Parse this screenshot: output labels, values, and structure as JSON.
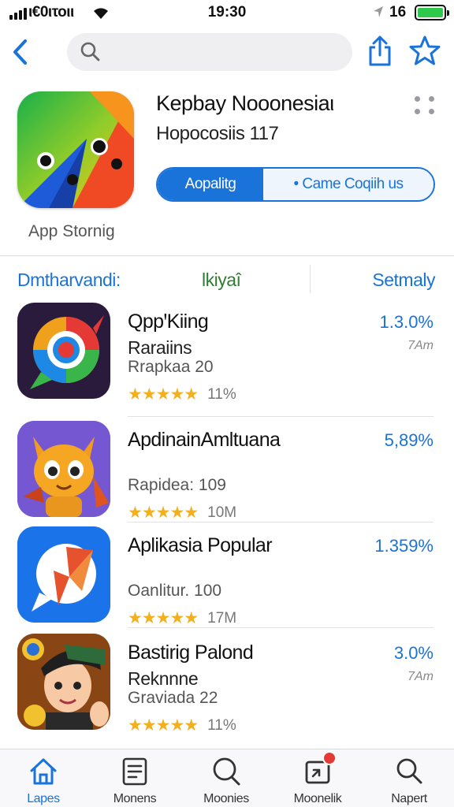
{
  "status_bar": {
    "carrier": "ι€0ιτοιι",
    "time": "19:30",
    "battery_pct": "16"
  },
  "nav": {
    "search_placeholder": ""
  },
  "header": {
    "title": "Keрbay Noooneѕiaι",
    "subtitle": "Hopocosiis 117",
    "segment_left": "Aopalitg",
    "segment_right": "• Came Coqiih  us",
    "icon_caption": "App Stornig"
  },
  "tabs": {
    "tab1": "Dmtharvandi:",
    "tab2": "lkiyaî",
    "tab3": "Setmaly"
  },
  "list": [
    {
      "title": "QppꞌKiing",
      "line2": "Raraiins",
      "line3": "Rrapkaa 20",
      "stars": "★★★★★",
      "count": "11%",
      "pct": "1.3.0%",
      "time": "7Am"
    },
    {
      "title": "ApdinainAmltuana",
      "line2": "",
      "line3": "Rapidea: 109",
      "stars": "★★★★★",
      "count": "10M",
      "pct": "5,89%",
      "time": ""
    },
    {
      "title": "Aplikasia Popular",
      "line2": "",
      "line3": "Oanlitur. 100",
      "stars": "★★★★★",
      "count": "17M",
      "pct": "1.359%",
      "time": ""
    },
    {
      "title": "Bastirig Palond",
      "line2": "Reknnne",
      "line3": "Graviada 22",
      "stars": "★★★★★",
      "count": "11%",
      "pct": "3.0%",
      "time": "7Am"
    }
  ],
  "tabbar": {
    "t1": "Lapes",
    "t2": "Monens",
    "t3": "Moonies",
    "t4": "Moonelik",
    "t5": "Napert"
  },
  "colors": {
    "accent": "#1a73d9",
    "green_tab": "#2e7d32",
    "star": "#f2b01e",
    "badge": "#e53935"
  }
}
